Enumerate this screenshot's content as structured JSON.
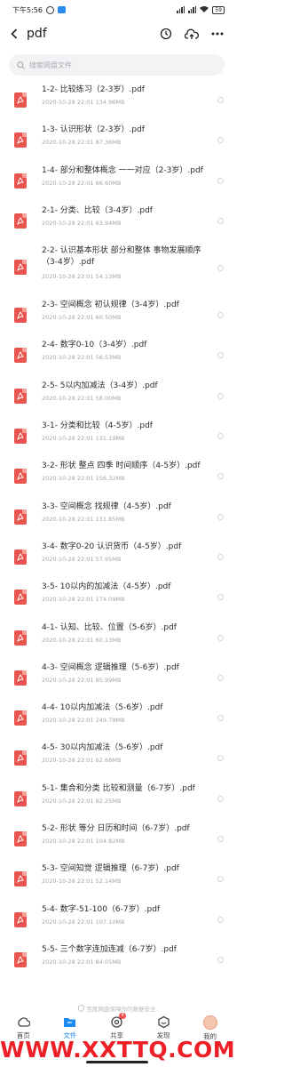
{
  "status_bar": {
    "time": "下午5:56",
    "battery": "59"
  },
  "nav": {
    "title": "pdf"
  },
  "search": {
    "placeholder": "搜索网盘文件"
  },
  "files": [
    {
      "name": "1-2- 比较练习（2-3岁）.pdf",
      "meta": "2020-10-28  22:01  134.96MB"
    },
    {
      "name": "1-3- 认识形状（2-3岁）.pdf",
      "meta": "2020-10-28  22:01  87.36MB"
    },
    {
      "name": "1-4- 部分和整体概念 一一对应（2-3岁）.pdf",
      "meta": "2020-10-28  22:01  66.60MB"
    },
    {
      "name": "2-1- 分类、比较（3-4岁）.pdf",
      "meta": "2020-10-28  22:01  63.94MB"
    },
    {
      "name": "2-2- 认识基本形状 部分和整体 事物发展顺序（3-4岁）.pdf",
      "meta": "2020-10-28  22:01  54.13MB",
      "two_line": true
    },
    {
      "name": "2-3- 空间概念 初认规律（3-4岁）.pdf",
      "meta": "2020-10-28  22:01  60.50MB"
    },
    {
      "name": "2-4- 数字0-10（3-4岁）.pdf",
      "meta": "2020-10-28  22:01  56.53MB"
    },
    {
      "name": "2-5- 5以内加减法（3-4岁）.pdf",
      "meta": "2020-10-28  22:01  58.00MB"
    },
    {
      "name": "3-1- 分类和比较（4-5岁）.pdf",
      "meta": "2020-10-28  22:01  131.19MB"
    },
    {
      "name": "3-2- 形状 整点 四季 时间顺序（4-5岁）.pdf",
      "meta": "2020-10-28  22:01  156.32MB"
    },
    {
      "name": "3-3- 空间概念 找规律（4-5岁）.pdf",
      "meta": "2020-10-28  22:01  131.85MB"
    },
    {
      "name": "3-4- 数字0-20 认识货币（4-5岁）.pdf",
      "meta": "2020-10-28  22:01  57.95MB"
    },
    {
      "name": "3-5- 10以内的加减法（4-5岁）.pdf",
      "meta": "2020-10-28  22:01  174.09MB"
    },
    {
      "name": "4-1- 认知、比较、位置（5-6岁）.pdf",
      "meta": "2020-10-28  22:01  60.13MB"
    },
    {
      "name": "4-3- 空间概念 逻辑推理（5-6岁）.pdf",
      "meta": "2020-10-28  22:01  85.99MB"
    },
    {
      "name": "4-4- 10以内加减法（5-6岁）.pdf",
      "meta": "2020-10-28  22:01  249.78MB"
    },
    {
      "name": "4-5- 30以内加减法（5-6岁）.pdf",
      "meta": "2020-10-28  22:01  62.68MB"
    },
    {
      "name": "5-1- 集合和分类 比较和测量（6-7岁）.pdf",
      "meta": "2020-10-28  22:01  82.25MB"
    },
    {
      "name": "5-2- 形状 等分 日历和时间（6-7岁）.pdf",
      "meta": "2020-10-28  22:01  104.82MB"
    },
    {
      "name": "5-3- 空间知觉 逻辑推理（6-7岁）.pdf",
      "meta": "2020-10-28  22:01  52.14MB"
    },
    {
      "name": "5-4- 数字-51-100（6-7岁）.pdf",
      "meta": "2020-10-28  22:01  107.10MB"
    },
    {
      "name": "5-5- 三个数字连加连减（6-7岁）.pdf",
      "meta": "2020-10-28  22:01  84.05MB"
    }
  ],
  "safety_note": "百度网盘保障你的数据安全",
  "tabs": [
    {
      "label": "首页",
      "icon": "home-icon"
    },
    {
      "label": "文件",
      "icon": "folder-icon",
      "active": true
    },
    {
      "label": "共享",
      "icon": "share-icon",
      "badge": "4"
    },
    {
      "label": "发现",
      "icon": "discover-icon"
    },
    {
      "label": "我的",
      "icon": "avatar"
    }
  ],
  "watermark": "WWW.XXTTQ.COM",
  "colors": {
    "accent": "#1b8cf1",
    "pdf_icon": "#e8554e",
    "watermark": "#ec2026"
  }
}
